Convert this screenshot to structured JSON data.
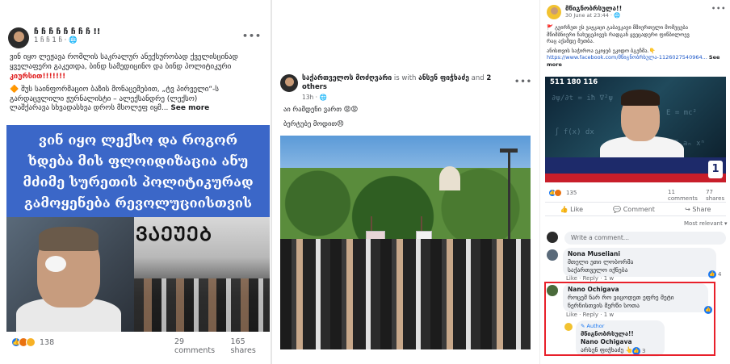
{
  "post1": {
    "author": "ჩ ჩ ჩ ჩ ჩ ჩ ჩ ჩ !!",
    "meta": "1 ჩ ჩ 1 ჩ · 🌐",
    "text_line1": "ვინ იყო ლეჟავა რომლის საკრალურ ანექსურობად ქველისცინად",
    "text_line2": "ყველაფერი გაკეთდა, ბინდ სამედიცინო და ბინდ პოლიტიკური",
    "text_line3": "კიურსით!!!!!!!",
    "text_line4": "🔶 შუს საინფორმაციო ბაზის მონაცემებით, „ტვ პირველი“-ს",
    "text_line5": "გარდაცვლილი ჟურნალისტი – ალექსანდრე (ლექსო)",
    "text_line6": "ლაშქარავა სხვადასხვა დროს მსოლეფ იყმ...",
    "see_more": "See more",
    "banner_lines": [
      "ვინ იყო ლექსო და როგორ",
      "ხდება მის ფლოიდიზაცია ანუ",
      "მძიმე სურეთის პოლიტიკურად",
      "გამოყენება რევოლუციისთვის"
    ],
    "wall_text": "ᲕᲐᲔᲣᲔᲑ",
    "reaction_count": "138",
    "comments": "29 comments",
    "shares": "165 shares"
  },
  "post2": {
    "author": "საქართველოს მოძღვარი",
    "author_rest": "is with",
    "with": "ანსენ ფიჭხაძე",
    "and": "and",
    "others": "2 others",
    "time": "13h · 🌐",
    "line1": "აი რამდენი ვართ 😡😡",
    "line2": "ბერტუბე მოდით😠"
  },
  "post3": {
    "author": "მწიგნობრსულა!!",
    "time": "30 June at 23:44 · 🌐",
    "line1": "🚩 გვირჩეთ ეს ვაჟკაცი გაბავკავი მშიერთელი მომეცება",
    "line2": "მწიმბნიერი ნახუცეპივეს რადგან ყვეცადერი ფიწბილოევ",
    "line3": "რაც აქამდე მეთბა.",
    "line4": "ანისთვის საჭიროა ეკიჯებ ეკიდო ბგეჩმა.👇",
    "link": "https://www.facebook.com/მწიგნობრსულა-1126027540964...",
    "see_more": "See more",
    "live_number": "511 180 116",
    "tv_logo": "1",
    "reaction_count": "135",
    "comments": "11 comments",
    "shares": "77 shares",
    "like": "Like",
    "comment": "Comment",
    "share": "Share",
    "most_relevant": "Most relevant ▾",
    "write_placeholder": "Write a comment...",
    "c1_name": "Nona Museliani",
    "c1_text1": "მთელი ეთი ლობორმა",
    "c1_text2": "საქართველო იქნება",
    "c1_likes": "4",
    "c1_actions": "Like · Reply · 1 w",
    "c2_name": "Nano Ochigava",
    "c2_text1": "როცემ ნარ რო ვიცოდეთ ეფრე მეტი",
    "c2_text2": "ნერნისთვის მერწი სოთა",
    "c2_actions": "Like · Reply · 1 w",
    "reply_badge": "✎ Author",
    "reply_name": "მწიგნობრსულა!!",
    "reply_target": "Nano Ochigava",
    "reply_text": "არსენ ფიჭხაძე 👆",
    "reply_likes": "3"
  }
}
